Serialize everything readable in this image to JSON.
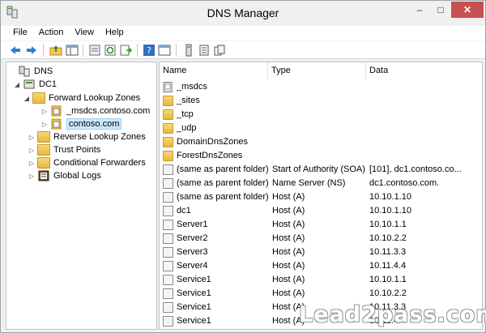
{
  "window": {
    "title": "DNS Manager",
    "minimize": "–",
    "maximize": "□",
    "close": "✕"
  },
  "menu": [
    "File",
    "Action",
    "View",
    "Help"
  ],
  "tree": [
    {
      "label": "DNS",
      "icon": "dns-icon",
      "arrow": ""
    },
    {
      "label": "DC1",
      "icon": "server-icon",
      "arrow": "◢"
    },
    {
      "label": "Forward Lookup Zones",
      "icon": "folder-icon",
      "arrow": "◢"
    },
    {
      "label": "_msdcs.contoso.com",
      "icon": "zone-icon",
      "arrow": "▷"
    },
    {
      "label": "contoso.com",
      "icon": "zone-icon",
      "arrow": "▷"
    },
    {
      "label": "Reverse Lookup Zones",
      "icon": "folder-icon",
      "arrow": "▷"
    },
    {
      "label": "Trust Points",
      "icon": "folder-icon",
      "arrow": "▷"
    },
    {
      "label": "Conditional Forwarders",
      "icon": "folder-icon",
      "arrow": "▷"
    },
    {
      "label": "Global Logs",
      "icon": "log-icon",
      "arrow": "▷"
    }
  ],
  "columns": [
    "Name",
    "Type",
    "Data"
  ],
  "rows": [
    {
      "name": "_msdcs",
      "type": "",
      "data": "",
      "icon": "zone-icon"
    },
    {
      "name": "_sites",
      "type": "",
      "data": "",
      "icon": "folder-icon"
    },
    {
      "name": "_tcp",
      "type": "",
      "data": "",
      "icon": "folder-icon"
    },
    {
      "name": "_udp",
      "type": "",
      "data": "",
      "icon": "folder-icon"
    },
    {
      "name": "DomainDnsZones",
      "type": "",
      "data": "",
      "icon": "folder-icon"
    },
    {
      "name": "ForestDnsZones",
      "type": "",
      "data": "",
      "icon": "folder-icon"
    },
    {
      "name": "(same as parent folder)",
      "type": "Start of Authority (SOA)",
      "data": "[101], dc1.contoso.co...",
      "icon": "record-icon"
    },
    {
      "name": "(same as parent folder)",
      "type": "Name Server (NS)",
      "data": "dc1.contoso.com.",
      "icon": "record-icon"
    },
    {
      "name": "(same as parent folder)",
      "type": "Host (A)",
      "data": "10.10.1.10",
      "icon": "record-icon"
    },
    {
      "name": "dc1",
      "type": "Host (A)",
      "data": "10.10.1.10",
      "icon": "record-icon"
    },
    {
      "name": "Server1",
      "type": "Host (A)",
      "data": "10.10.1.1",
      "icon": "record-icon"
    },
    {
      "name": "Server2",
      "type": "Host (A)",
      "data": "10.10.2.2",
      "icon": "record-icon"
    },
    {
      "name": "Server3",
      "type": "Host (A)",
      "data": "10.11.3.3",
      "icon": "record-icon"
    },
    {
      "name": "Server4",
      "type": "Host (A)",
      "data": "10.11.4.4",
      "icon": "record-icon"
    },
    {
      "name": "Service1",
      "type": "Host (A)",
      "data": "10.10.1.1",
      "icon": "record-icon"
    },
    {
      "name": "Service1",
      "type": "Host (A)",
      "data": "10.10.2.2",
      "icon": "record-icon"
    },
    {
      "name": "Service1",
      "type": "Host (A)",
      "data": "10.11.3.3",
      "icon": "record-icon"
    },
    {
      "name": "Service1",
      "type": "Host (A)",
      "data": "10.11.4.4",
      "icon": "record-icon"
    }
  ],
  "watermark": "Lead2pass.com",
  "colors": {
    "close_button": "#c75050",
    "selection": "#cce8ff",
    "folder": "#f1c75a"
  }
}
